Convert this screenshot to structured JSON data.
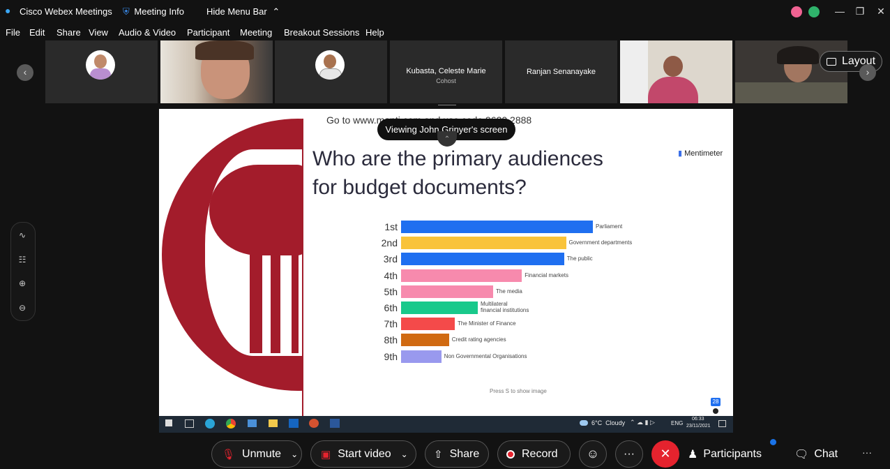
{
  "titlebar": {
    "app_name": "Cisco Webex Meetings",
    "meeting_info": "Meeting Info",
    "hide_menu": "Hide Menu Bar"
  },
  "menu": [
    "File",
    "Edit",
    "Share",
    "View",
    "Audio & Video",
    "Participant",
    "Meeting",
    "Breakout Sessions",
    "Help"
  ],
  "participants": {
    "p4_name": "Kubasta, Celeste Marie",
    "p4_role": "Cohost",
    "p5_name": "Ranjan Senanayake"
  },
  "layout_label": "Layout",
  "share": {
    "viewing_banner": "Viewing John Grinyer's screen",
    "goto_text": "Go to www.menti.com and use code 9620 2888",
    "brand": "Mentimeter",
    "question_line1": "Who are the primary audiences",
    "question_line2": "for budget documents?",
    "footer": "Press S to show image",
    "response_count": "28"
  },
  "chart_data": {
    "type": "bar",
    "orientation": "horizontal",
    "categories": [
      "1st",
      "2nd",
      "3rd",
      "4th",
      "5th",
      "6th",
      "7th",
      "8th",
      "9th"
    ],
    "labels": [
      "Parliament",
      "Government departments",
      "The public",
      "Financial markets",
      "The media",
      "Multilateral financial institutions",
      "The Minister of Finance",
      "Credit rating agencies",
      "Non Governmental Organisations"
    ],
    "values": [
      100,
      86,
      85,
      63,
      48,
      40,
      28,
      25,
      21
    ],
    "colors": [
      "#1f6ff0",
      "#f9c33a",
      "#1f6ff0",
      "#f78aad",
      "#f78aad",
      "#19c98b",
      "#f44a4a",
      "#d06a12",
      "#9999ee"
    ]
  },
  "taskbar": {
    "weather": "6°C  Cloudy",
    "lang": "ENG",
    "time": "06:33",
    "date": "23/11/2021"
  },
  "controls": {
    "unmute": "Unmute",
    "start_video": "Start video",
    "share": "Share",
    "record": "Record",
    "more": "···",
    "participants": "Participants",
    "chat": "Chat",
    "overflow": "···"
  },
  "colors": {
    "end_call": "#e5232e",
    "record_dot": "#e5232e",
    "accent": "#1a73e8"
  }
}
